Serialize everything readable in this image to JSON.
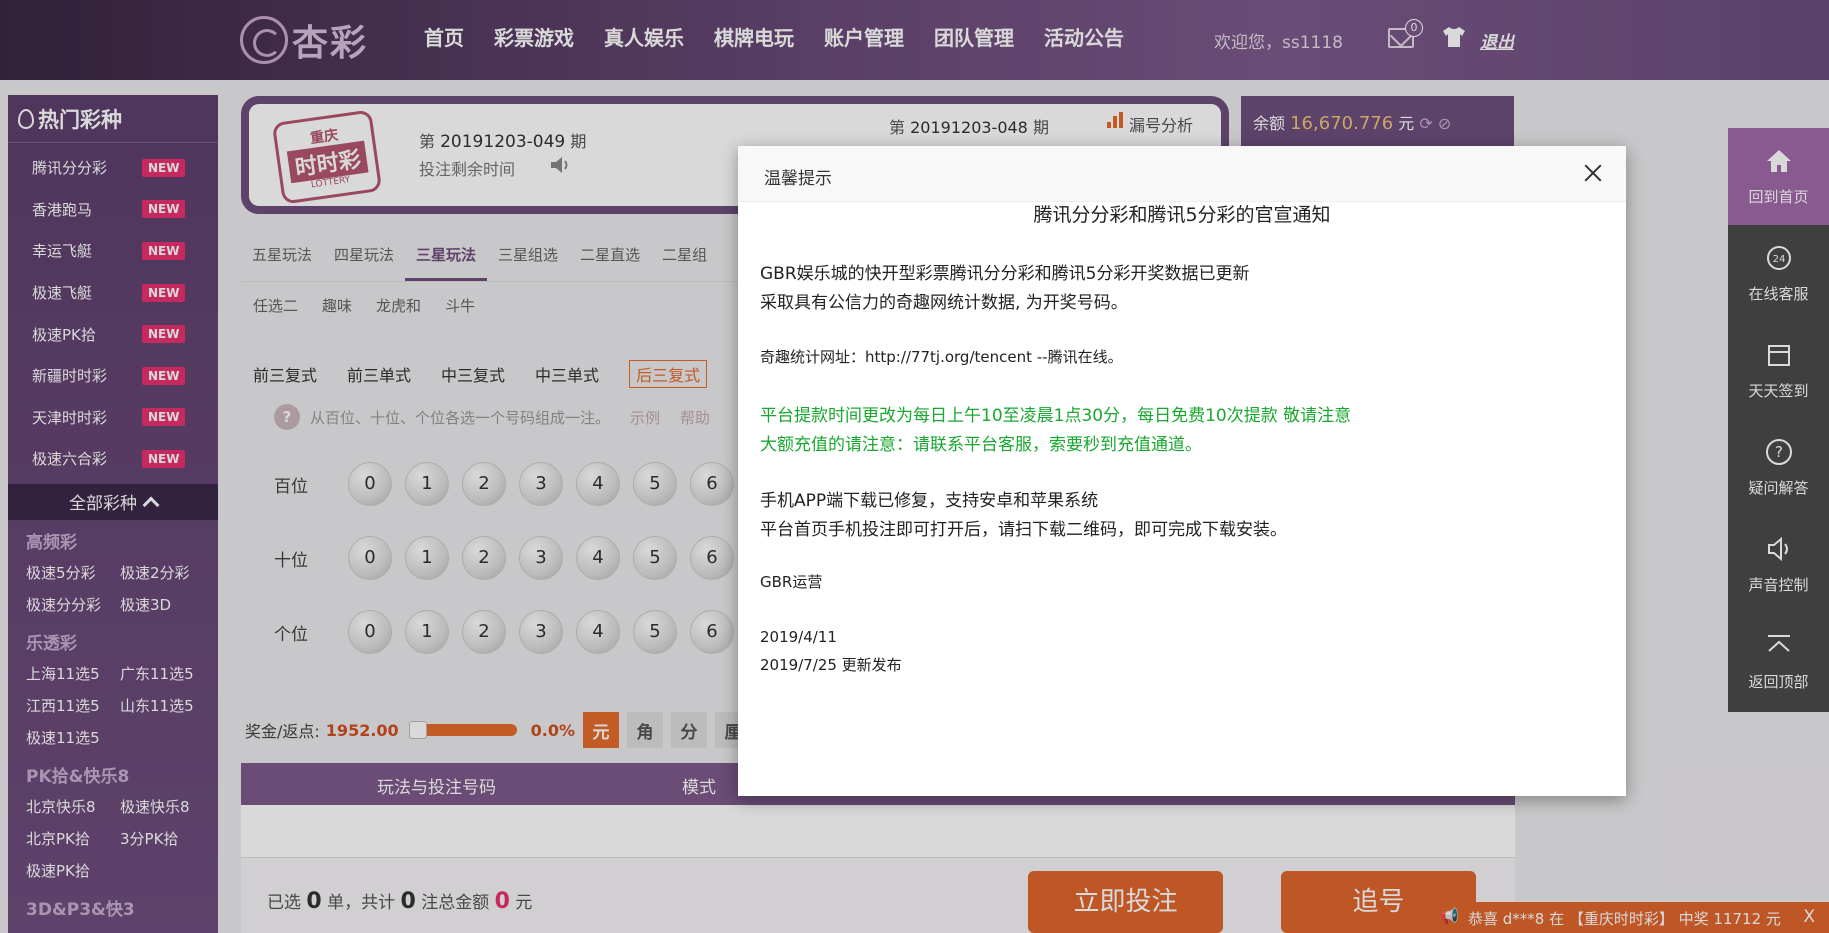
{
  "header": {
    "logo_text": "杏彩",
    "nav": [
      "首页",
      "彩票游戏",
      "真人娱乐",
      "棋牌电玩",
      "账户管理",
      "团队管理",
      "活动公告"
    ],
    "welcome": "欢迎您，ss1118",
    "mail_count": "0",
    "logout": "退出"
  },
  "sidebar": {
    "title": "热门彩种",
    "hot": [
      {
        "label": "腾讯分分彩",
        "badge": "NEW"
      },
      {
        "label": "香港跑马",
        "badge": "NEW"
      },
      {
        "label": "幸运飞艇",
        "badge": "NEW"
      },
      {
        "label": "极速飞艇",
        "badge": "NEW"
      },
      {
        "label": "极速PK拾",
        "badge": "NEW"
      },
      {
        "label": "新疆时时彩",
        "badge": "NEW"
      },
      {
        "label": "天津时时彩",
        "badge": "NEW"
      },
      {
        "label": "极速六合彩",
        "badge": "NEW"
      }
    ],
    "all_label": "全部彩种",
    "groups": [
      {
        "title": "高频彩",
        "items": [
          "极速5分彩",
          "极速2分彩",
          "极速分分彩",
          "极速3D"
        ]
      },
      {
        "title": "乐透彩",
        "items": [
          "上海11选5",
          "广东11选5",
          "江西11选5",
          "山东11选5",
          "极速11选5"
        ]
      },
      {
        "title": "PK拾&快乐8",
        "items": [
          "北京快乐8",
          "极速快乐8",
          "北京PK拾",
          "3分PK拾",
          "极速PK拾"
        ]
      },
      {
        "title": "3D&P3&快3",
        "items": []
      }
    ]
  },
  "lottery": {
    "logo_top": "重庆",
    "logo_main": "时时彩",
    "logo_sub": "LOTTERY",
    "period_prefix": "第",
    "period": "20191203-049",
    "period_suffix": "期",
    "remain": "投注剩余时间",
    "prev_prefix": "第",
    "prev_period": "20191203-048",
    "prev_suffix": "期",
    "leak": "漏号分析"
  },
  "balance": {
    "label": "余额",
    "amount": "16,670.776",
    "unit": "元"
  },
  "tabs": [
    "五星玩法",
    "四星玩法",
    "三星玩法",
    "三星组选",
    "二星直选",
    "二星组"
  ],
  "active_tab": "三星玩法",
  "tabs2": [
    "任选二",
    "趣味",
    "龙虎和",
    "斗牛"
  ],
  "subplays": [
    "前三复式",
    "前三单式",
    "中三复式",
    "中三单式",
    "后三复式",
    "后"
  ],
  "active_subplay": "后三复式",
  "hint": {
    "text": "从百位、十位、个位各选一个号码组成一注。",
    "example": "示例",
    "help": "帮助"
  },
  "positions": [
    "百位",
    "十位",
    "个位"
  ],
  "digits": [
    "0",
    "1",
    "2",
    "3",
    "4",
    "5",
    "6"
  ],
  "prize": {
    "label": "奖金/返点:",
    "value": "1952.00",
    "rebate": "0.0%",
    "units": [
      "元",
      "角",
      "分",
      "厘"
    ],
    "active_unit": "元"
  },
  "table": {
    "col1": "玩法与投注号码",
    "col2": "模式"
  },
  "footer": {
    "p1": "已选",
    "count": "0",
    "p2": "单，共计",
    "notes": "0",
    "p3": "注总金额",
    "amount": "0",
    "p4": "元",
    "bet": "立即投注",
    "chase": "追号"
  },
  "ticker": "恭喜 d***8 在 【重庆时时彩】 中奖 11712 元",
  "ticker_close": "X",
  "rightbar": [
    "回到首页",
    "在线客服",
    "天天签到",
    "疑问解答",
    "声音控制",
    "返回顶部"
  ],
  "modal": {
    "header": "温馨提示",
    "title": "腾讯分分彩和腾讯5分彩的官宣通知",
    "l1": "GBR娱乐城的快开型彩票腾讯分分彩和腾讯5分彩开奖数据已更新",
    "l2": "采取具有公信力的奇趣网统计数据, 为开奖号码。",
    "l3": "奇趣统计网址：http://77tj.org/tencent --腾讯在线。",
    "l4": " 平台提款时间更改为每日上午10至凌晨1点30分，每日免费10次提款 敬请注意",
    "l5": "大额充值的请注意：请联系平台客服，索要秒到充值通道。",
    "l6": " 手机APP端下载已修复，支持安卓和苹果系统",
    "l7": "平台首页手机投注即可打开后，请扫下载二维码，即可完成下载安装。",
    "l8": "GBR运营",
    "l9": "2019/4/11",
    "l10": "2019/7/25 更新发布"
  },
  "colors": {
    "brand": "#6e4f7d",
    "accent": "#e0662c",
    "badge": "#e8316f",
    "green": "#19a82f"
  }
}
